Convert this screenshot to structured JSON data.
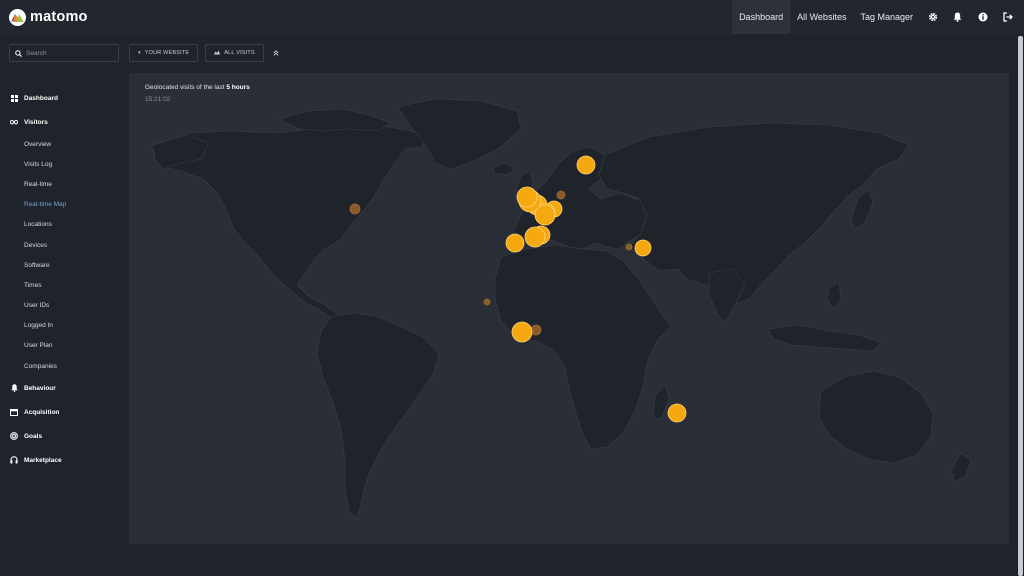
{
  "app": {
    "logo_text": "matomo"
  },
  "topnav": {
    "items": [
      "Dashboard",
      "All Websites",
      "Tag Manager"
    ],
    "active": "Dashboard",
    "icons": [
      "gear-icon",
      "bell-icon",
      "info-icon",
      "logout-icon"
    ]
  },
  "search": {
    "placeholder": "Search"
  },
  "filters": {
    "website": "YOUR WEBSITE",
    "segment": "ALL VISITS"
  },
  "menu": {
    "dashboard": "Dashboard",
    "visitors": "Visitors",
    "visitors_sub": [
      "Overview",
      "Visits Log",
      "Real-time",
      "Real-time Map",
      "Locations",
      "Devices",
      "Software",
      "Times",
      "User IDs",
      "Logged In",
      "User Plan",
      "Companies"
    ],
    "active_sub": "Real-time Map",
    "behaviour": "Behaviour",
    "acquisition": "Acquisition",
    "goals": "Goals",
    "marketplace": "Marketplace"
  },
  "map": {
    "title_prefix": "Geolocated visits of the last",
    "title_strong": "5 hours",
    "time": "15:21:02",
    "colors": {
      "recent": "#f5a90f",
      "old": "#8a5a2a",
      "land": "#1f232a",
      "border": "#3a3f48"
    }
  }
}
